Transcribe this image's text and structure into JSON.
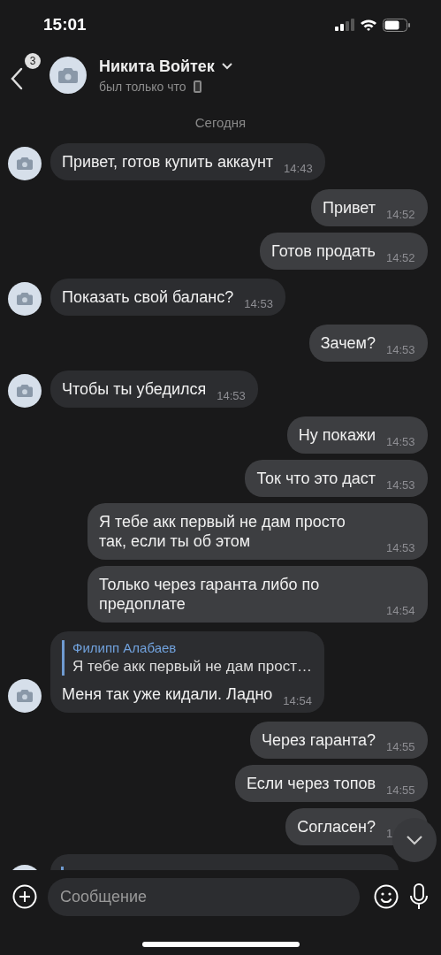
{
  "status_bar": {
    "time": "15:01"
  },
  "header": {
    "unread_count": "3",
    "name": "Никита Войтек",
    "status": "был только что"
  },
  "date_separator": "Сегодня",
  "messages": [
    {
      "kind": "incoming",
      "text": "Привет, готов купить аккаунт",
      "time": "14:43"
    },
    {
      "kind": "outgoing",
      "text": "Привет",
      "time": "14:52"
    },
    {
      "kind": "outgoing",
      "text": "Готов продать",
      "time": "14:52"
    },
    {
      "kind": "incoming",
      "text": "Показать свой баланс?",
      "time": "14:53"
    },
    {
      "kind": "outgoing",
      "text": "Зачем?",
      "time": "14:53"
    },
    {
      "kind": "incoming",
      "text": "Чтобы ты убедился",
      "time": "14:53"
    },
    {
      "kind": "outgoing",
      "text": "Ну покажи",
      "time": "14:53"
    },
    {
      "kind": "outgoing",
      "text": "Ток что это даст",
      "time": "14:53"
    },
    {
      "kind": "outgoing",
      "text": "Я тебе акк первый не дам просто так, если ты об этом",
      "time": "14:53"
    },
    {
      "kind": "outgoing",
      "text": "Только через гаранта либо по предоплате",
      "time": "14:54"
    },
    {
      "kind": "incoming",
      "text": "Меня так уже кидали. Ладно",
      "time": "14:54",
      "reply": {
        "author": "Филипп Алабаев",
        "text": "Я тебе акк первый не дам прост…"
      }
    },
    {
      "kind": "outgoing",
      "text": "Через гаранта?",
      "time": "14:55"
    },
    {
      "kind": "outgoing",
      "text": "Если через топов",
      "time": "14:55"
    },
    {
      "kind": "outgoing",
      "text": "Согласен?",
      "time": "1"
    },
    {
      "kind": "cut_off"
    }
  ],
  "composer": {
    "placeholder": "Сообщение"
  }
}
